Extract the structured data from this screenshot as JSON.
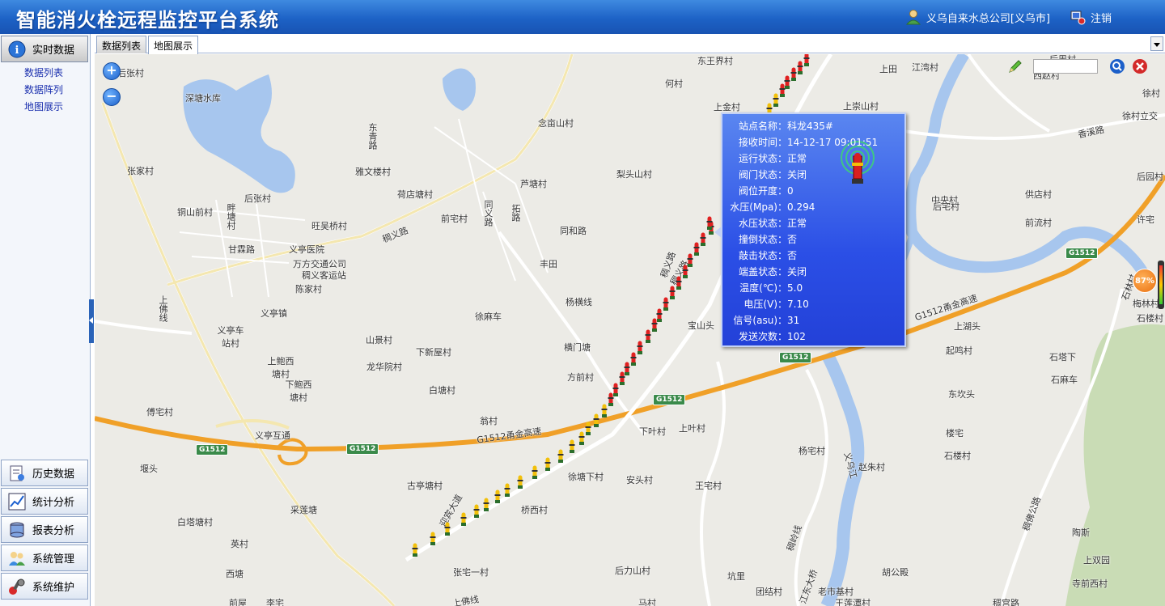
{
  "header": {
    "title": "智能消火栓远程监控平台系统",
    "user": "义乌自来水总公司[义乌市]",
    "logout": "注销"
  },
  "sidebar": {
    "realtime": "实时数据",
    "sub_items": [
      "数据列表",
      "数据阵列",
      "地图展示"
    ],
    "bottom_items": [
      "历史数据",
      "统计分析",
      "报表分析",
      "系统管理",
      "系统维护"
    ]
  },
  "tabs": [
    "数据列表",
    "地图展示"
  ],
  "map": {
    "zoom_in": "+",
    "zoom_out": "−",
    "search_placeholder": "",
    "signal_percent": "87%",
    "places": [
      "后张村",
      "深塘水库",
      "何村",
      "东王界村",
      "上田",
      "江湾村",
      "后周村",
      "西赵村",
      "徐村",
      "上金村",
      "上崇山村",
      "徐村立交",
      "念亩山村",
      "张家村",
      "雅文楼村",
      "东青路",
      "香溪路",
      "梨头山村",
      "后园村",
      "后张村",
      "荷店塘村",
      "芦塘村",
      "铜山前村",
      "旺吴桥村",
      "中央村",
      "供店村",
      "前宅村",
      "同义路",
      "拓路",
      "同和路",
      "后宅村",
      "前流村",
      "许宅",
      "畔塘村",
      "甘霖路",
      "稠义路",
      "义亭医院",
      "万方交通公司",
      "稠义客运站",
      "丰田",
      "陈家村",
      "稠义路",
      "上佛线",
      "义亭镇",
      "杨横线",
      "徐麻车",
      "义亭车站村",
      "山景村",
      "宝山头",
      "上湖头",
      "起鸣村",
      "石塔下",
      "石麻车",
      "下新屋村",
      "龙华院村",
      "横门塘",
      "上鲍西塘村",
      "下鲍西塘村",
      "方前村",
      "白塘村",
      "东坎头",
      "傅宅村",
      "翁村",
      "下叶村",
      "上叶村",
      "义亭互通",
      "楼宅",
      "石楼村",
      "G1512甬金高速",
      "G1512甬金高速",
      "杨宅村",
      "赵朱村",
      "堰头",
      "古亭塘村",
      "徐塘下村",
      "安头村",
      "王宅村",
      "采莲塘",
      "迎宾大道",
      "桥西村",
      "白塔塘村",
      "英村",
      "陶斯",
      "上双园",
      "张宅一村",
      "后力山村",
      "坑里",
      "团结村",
      "老市基村",
      "胡公殿",
      "寺前西村",
      "西塘",
      "前屋",
      "李宅",
      "上佛线",
      "马村",
      "王莲潭村",
      "稠宫路",
      "稠佛公路",
      "稠岭线",
      "义乌江",
      "江东大桥",
      "梅林村",
      "石楼村",
      "石林村",
      "稠义路"
    ],
    "road_badges": [
      "G1512",
      "G1512",
      "G1512",
      "G1512",
      "G1512"
    ]
  },
  "popup": {
    "rows": [
      {
        "label": "站点名称：",
        "value": "科龙435#"
      },
      {
        "label": "接收时间：",
        "value": "14-12-17 09:01:51"
      },
      {
        "label": "运行状态：",
        "value": "正常"
      },
      {
        "label": "阀门状态：",
        "value": "关闭"
      },
      {
        "label": "阀位开度：",
        "value": "0"
      },
      {
        "label": "水压(Mpa)：",
        "value": "0.294"
      },
      {
        "label": "水压状态：",
        "value": "正常"
      },
      {
        "label": "撞倒状态：",
        "value": "否"
      },
      {
        "label": "敲击状态：",
        "value": "否"
      },
      {
        "label": "端盖状态：",
        "value": "关闭"
      },
      {
        "label": "温度(℃)：",
        "value": "5.0"
      },
      {
        "label": "电压(V)：",
        "value": "7.10"
      },
      {
        "label": "信号(asu)：",
        "value": "31"
      },
      {
        "label": "发送次数：",
        "value": "102"
      }
    ]
  },
  "colors": {
    "header": "#1d62c6",
    "popup": "#2b4fe6",
    "highway": "#f0a028",
    "water": "#a7c6ee",
    "hydrant_red": "#e02020",
    "hydrant_yellow": "#f2c00a"
  }
}
